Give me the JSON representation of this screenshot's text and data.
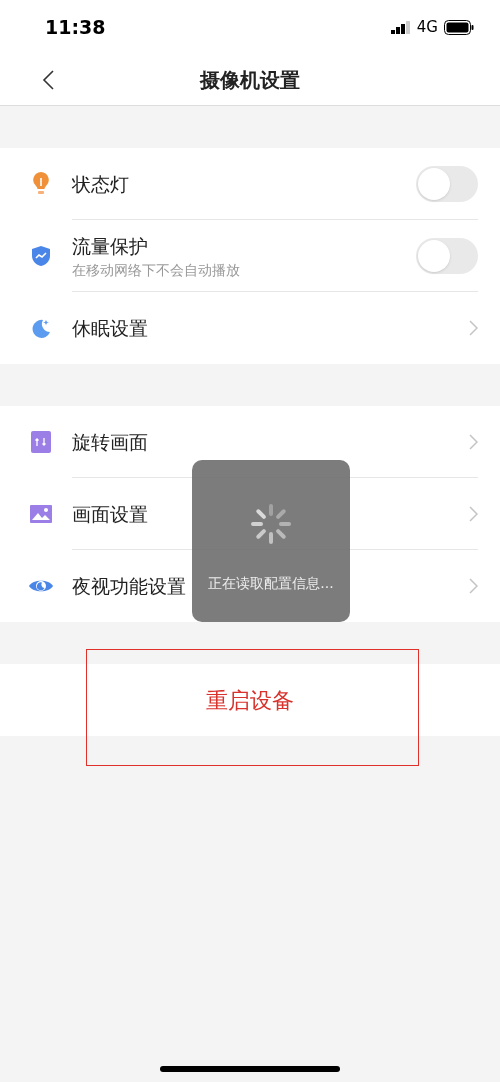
{
  "status_bar": {
    "time": "11:38",
    "network": "4G"
  },
  "nav": {
    "title": "摄像机设置"
  },
  "groups": [
    {
      "items": [
        {
          "kind": "toggle",
          "label": "状态灯",
          "on": false
        },
        {
          "kind": "toggle",
          "label": "流量保护",
          "subtitle": "在移动网络下不会自动播放",
          "on": false
        },
        {
          "kind": "link",
          "label": "休眠设置"
        }
      ]
    },
    {
      "items": [
        {
          "kind": "link",
          "label": "旋转画面"
        },
        {
          "kind": "link",
          "label": "画面设置"
        },
        {
          "kind": "link",
          "label": "夜视功能设置"
        }
      ]
    }
  ],
  "restart_button": {
    "label": "重启设备"
  },
  "toast": {
    "message": "正在读取配置信息..."
  }
}
